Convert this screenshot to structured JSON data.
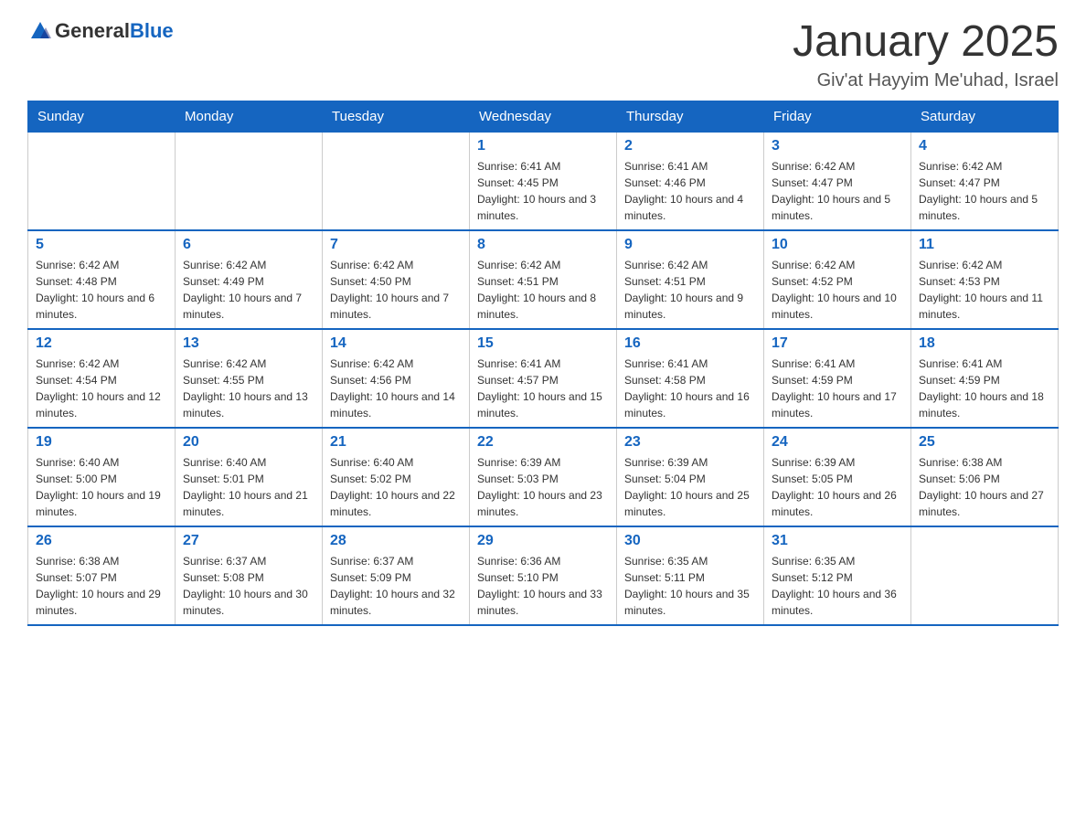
{
  "header": {
    "logo": {
      "general": "General",
      "blue": "Blue"
    },
    "title": "January 2025",
    "subtitle": "Giv'at Hayyim Me'uhad, Israel"
  },
  "weekdays": [
    "Sunday",
    "Monday",
    "Tuesday",
    "Wednesday",
    "Thursday",
    "Friday",
    "Saturday"
  ],
  "weeks": [
    [
      {
        "day": "",
        "info": ""
      },
      {
        "day": "",
        "info": ""
      },
      {
        "day": "",
        "info": ""
      },
      {
        "day": "1",
        "info": "Sunrise: 6:41 AM\nSunset: 4:45 PM\nDaylight: 10 hours and 3 minutes."
      },
      {
        "day": "2",
        "info": "Sunrise: 6:41 AM\nSunset: 4:46 PM\nDaylight: 10 hours and 4 minutes."
      },
      {
        "day": "3",
        "info": "Sunrise: 6:42 AM\nSunset: 4:47 PM\nDaylight: 10 hours and 5 minutes."
      },
      {
        "day": "4",
        "info": "Sunrise: 6:42 AM\nSunset: 4:47 PM\nDaylight: 10 hours and 5 minutes."
      }
    ],
    [
      {
        "day": "5",
        "info": "Sunrise: 6:42 AM\nSunset: 4:48 PM\nDaylight: 10 hours and 6 minutes."
      },
      {
        "day": "6",
        "info": "Sunrise: 6:42 AM\nSunset: 4:49 PM\nDaylight: 10 hours and 7 minutes."
      },
      {
        "day": "7",
        "info": "Sunrise: 6:42 AM\nSunset: 4:50 PM\nDaylight: 10 hours and 7 minutes."
      },
      {
        "day": "8",
        "info": "Sunrise: 6:42 AM\nSunset: 4:51 PM\nDaylight: 10 hours and 8 minutes."
      },
      {
        "day": "9",
        "info": "Sunrise: 6:42 AM\nSunset: 4:51 PM\nDaylight: 10 hours and 9 minutes."
      },
      {
        "day": "10",
        "info": "Sunrise: 6:42 AM\nSunset: 4:52 PM\nDaylight: 10 hours and 10 minutes."
      },
      {
        "day": "11",
        "info": "Sunrise: 6:42 AM\nSunset: 4:53 PM\nDaylight: 10 hours and 11 minutes."
      }
    ],
    [
      {
        "day": "12",
        "info": "Sunrise: 6:42 AM\nSunset: 4:54 PM\nDaylight: 10 hours and 12 minutes."
      },
      {
        "day": "13",
        "info": "Sunrise: 6:42 AM\nSunset: 4:55 PM\nDaylight: 10 hours and 13 minutes."
      },
      {
        "day": "14",
        "info": "Sunrise: 6:42 AM\nSunset: 4:56 PM\nDaylight: 10 hours and 14 minutes."
      },
      {
        "day": "15",
        "info": "Sunrise: 6:41 AM\nSunset: 4:57 PM\nDaylight: 10 hours and 15 minutes."
      },
      {
        "day": "16",
        "info": "Sunrise: 6:41 AM\nSunset: 4:58 PM\nDaylight: 10 hours and 16 minutes."
      },
      {
        "day": "17",
        "info": "Sunrise: 6:41 AM\nSunset: 4:59 PM\nDaylight: 10 hours and 17 minutes."
      },
      {
        "day": "18",
        "info": "Sunrise: 6:41 AM\nSunset: 4:59 PM\nDaylight: 10 hours and 18 minutes."
      }
    ],
    [
      {
        "day": "19",
        "info": "Sunrise: 6:40 AM\nSunset: 5:00 PM\nDaylight: 10 hours and 19 minutes."
      },
      {
        "day": "20",
        "info": "Sunrise: 6:40 AM\nSunset: 5:01 PM\nDaylight: 10 hours and 21 minutes."
      },
      {
        "day": "21",
        "info": "Sunrise: 6:40 AM\nSunset: 5:02 PM\nDaylight: 10 hours and 22 minutes."
      },
      {
        "day": "22",
        "info": "Sunrise: 6:39 AM\nSunset: 5:03 PM\nDaylight: 10 hours and 23 minutes."
      },
      {
        "day": "23",
        "info": "Sunrise: 6:39 AM\nSunset: 5:04 PM\nDaylight: 10 hours and 25 minutes."
      },
      {
        "day": "24",
        "info": "Sunrise: 6:39 AM\nSunset: 5:05 PM\nDaylight: 10 hours and 26 minutes."
      },
      {
        "day": "25",
        "info": "Sunrise: 6:38 AM\nSunset: 5:06 PM\nDaylight: 10 hours and 27 minutes."
      }
    ],
    [
      {
        "day": "26",
        "info": "Sunrise: 6:38 AM\nSunset: 5:07 PM\nDaylight: 10 hours and 29 minutes."
      },
      {
        "day": "27",
        "info": "Sunrise: 6:37 AM\nSunset: 5:08 PM\nDaylight: 10 hours and 30 minutes."
      },
      {
        "day": "28",
        "info": "Sunrise: 6:37 AM\nSunset: 5:09 PM\nDaylight: 10 hours and 32 minutes."
      },
      {
        "day": "29",
        "info": "Sunrise: 6:36 AM\nSunset: 5:10 PM\nDaylight: 10 hours and 33 minutes."
      },
      {
        "day": "30",
        "info": "Sunrise: 6:35 AM\nSunset: 5:11 PM\nDaylight: 10 hours and 35 minutes."
      },
      {
        "day": "31",
        "info": "Sunrise: 6:35 AM\nSunset: 5:12 PM\nDaylight: 10 hours and 36 minutes."
      },
      {
        "day": "",
        "info": ""
      }
    ]
  ]
}
